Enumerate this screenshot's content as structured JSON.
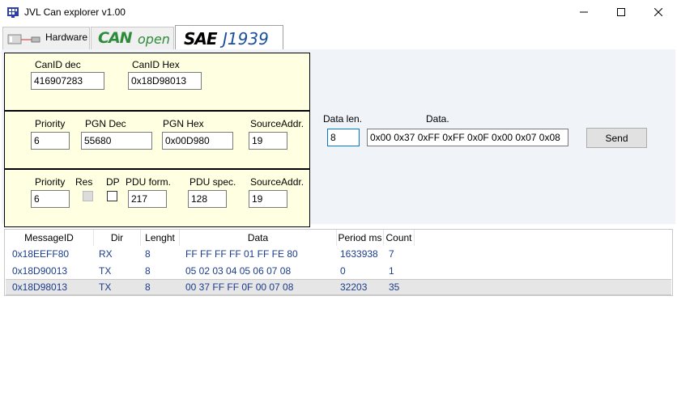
{
  "window": {
    "title": "JVL Can explorer v1.00",
    "controls": {
      "minimize": "—",
      "maximize": "☐",
      "close": "✕"
    }
  },
  "tabs": [
    {
      "label": "Hardware"
    },
    {
      "label_can": "CAN",
      "label_open": "open"
    },
    {
      "label_sae": "SAE",
      "label_j": "J1939"
    }
  ],
  "canid": {
    "dec_label": "CanID dec",
    "dec_value": "416907283",
    "hex_label": "CanID Hex",
    "hex_value": "0x18D98013"
  },
  "pgn_panel": {
    "priority_label": "Priority",
    "priority_value": "6",
    "pgn_dec_label": "PGN  Dec",
    "pgn_dec_value": "55680",
    "pgn_hex_label": "PGN  Hex",
    "pgn_hex_value": "0x00D980",
    "source_label": "SourceAddr.",
    "source_value": "19"
  },
  "pdu_panel": {
    "priority_label": "Priority",
    "priority_value": "6",
    "res_label": "Res",
    "dp_label": "DP",
    "pdu_form_label": "PDU form.",
    "pdu_form_value": "217",
    "pdu_spec_label": "PDU spec.",
    "pdu_spec_value": "128",
    "source_label": "SourceAddr.",
    "source_value": "19"
  },
  "send": {
    "data_len_label": "Data len.",
    "data_len_value": "8",
    "data_label": "Data.",
    "data_value": "0x00 0x37 0xFF 0xFF 0x0F 0x00 0x07 0x08",
    "button_label": "Send"
  },
  "grid": {
    "columns": [
      "MessageID",
      "Dir",
      "Lenght",
      "Data",
      "Period ms",
      "Count"
    ],
    "rows": [
      [
        "0x18EEFF80",
        "RX",
        "8",
        "FF FF FF FF 01 FF FE 80",
        "1633938",
        "7"
      ],
      [
        "0x18D90013",
        "TX",
        "8",
        "05 02 03 04 05 06 07 08",
        "0",
        "1"
      ],
      [
        "0x18D98013",
        "TX",
        "8",
        "00 37 FF FF 0F 00 07 08",
        "32203",
        "35"
      ]
    ],
    "selected_row": 2
  },
  "colors": {
    "panel_bg": "#ffffe1",
    "content_bg": "#f0f3f8",
    "grid_text": "#1a3c8c",
    "can_green": "#2e8b3a",
    "j1939_blue": "#1a4f9c"
  }
}
